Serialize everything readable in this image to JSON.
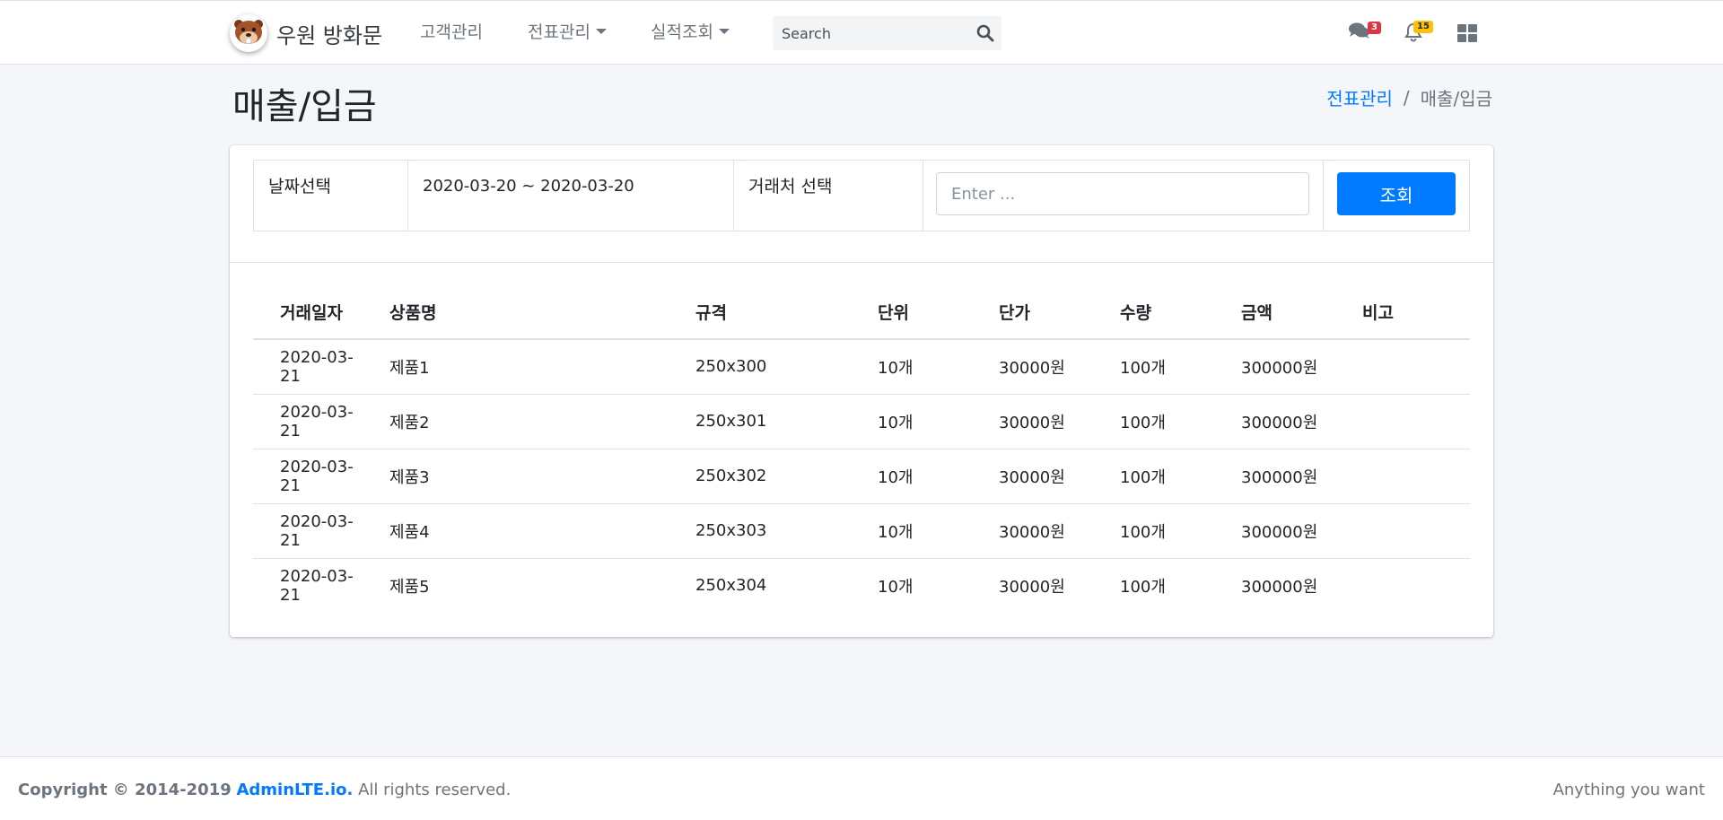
{
  "navbar": {
    "brand_text": "우원 방화문",
    "logo_icon": "beaver-logo-icon",
    "menu": [
      {
        "label": "고객관리",
        "dropdown": false
      },
      {
        "label": "전표관리",
        "dropdown": true
      },
      {
        "label": "실적조회",
        "dropdown": true
      }
    ],
    "search": {
      "placeholder": "Search",
      "value": "",
      "icon": "search-icon"
    },
    "messages": {
      "icon": "comments-icon",
      "count": "3",
      "badge_color": "#dc3545"
    },
    "notifications": {
      "icon": "bell-icon",
      "count": "15",
      "badge_color": "#ffc107"
    },
    "apps_icon": "th-large-icon"
  },
  "header": {
    "title": "매출/입금",
    "breadcrumb": {
      "parent": "전표관리",
      "separator": "/",
      "current": "매출/입금"
    }
  },
  "filter": {
    "date_label": "날짜선택",
    "date_range": "2020-03-20 ~ 2020-03-20",
    "client_label": "거래처 선택",
    "client_placeholder": "Enter ...",
    "client_value": "",
    "search_button": "조회"
  },
  "table": {
    "columns": [
      "거래일자",
      "상품명",
      "규격",
      "단위",
      "단가",
      "수량",
      "금액",
      "비고"
    ],
    "rows": [
      [
        "2020-03-21",
        "제품1",
        "250x300",
        "10개",
        "30000원",
        "100개",
        "300000원",
        ""
      ],
      [
        "2020-03-21",
        "제품2",
        "250x301",
        "10개",
        "30000원",
        "100개",
        "300000원",
        ""
      ],
      [
        "2020-03-21",
        "제품3",
        "250x302",
        "10개",
        "30000원",
        "100개",
        "300000원",
        ""
      ],
      [
        "2020-03-21",
        "제품4",
        "250x303",
        "10개",
        "30000원",
        "100개",
        "300000원",
        ""
      ],
      [
        "2020-03-21",
        "제품5",
        "250x304",
        "10개",
        "30000원",
        "100개",
        "300000원",
        ""
      ]
    ]
  },
  "footer": {
    "copyright_prefix": "Copyright © 2014-2019",
    "link_text": "AdminLTE.io.",
    "rights": "All rights reserved.",
    "right_text": "Anything you want"
  },
  "colors": {
    "primary": "#007bff",
    "background": "#f4f6f9",
    "danger": "#dc3545",
    "warning": "#ffc107"
  }
}
